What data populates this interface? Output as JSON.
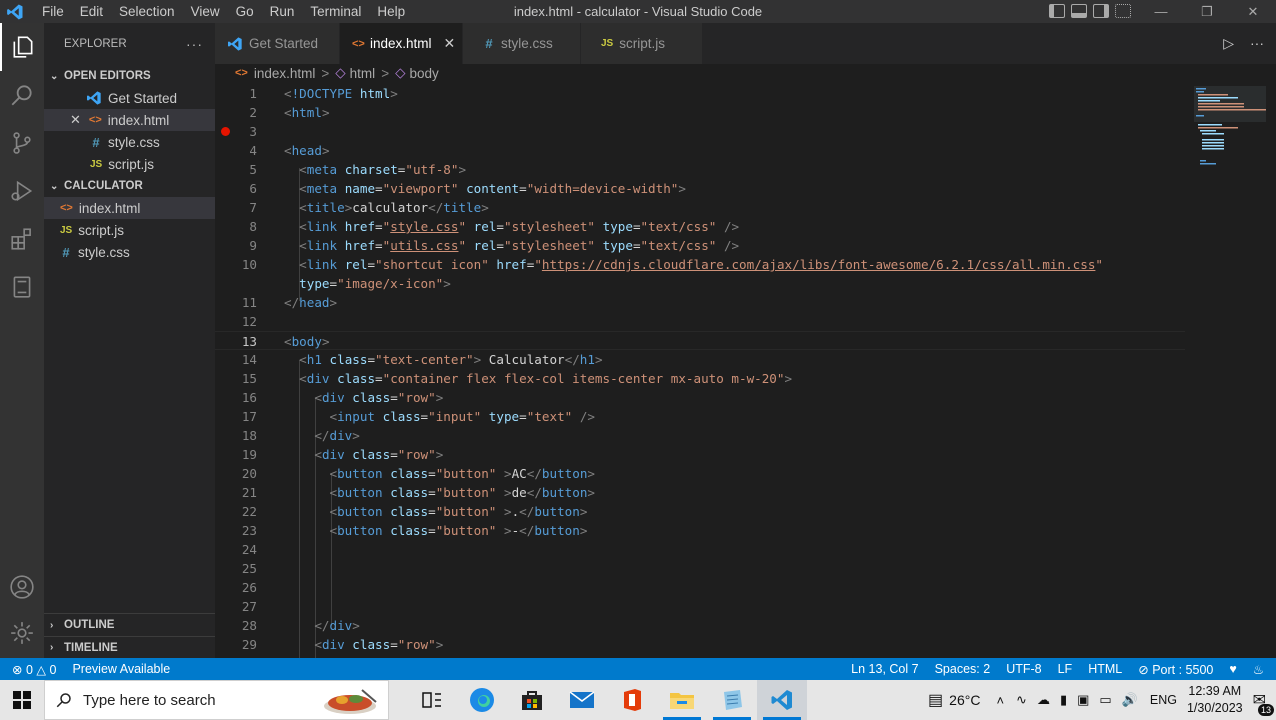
{
  "window": {
    "title": "index.html - calculator - Visual Studio Code",
    "menu": [
      "File",
      "Edit",
      "Selection",
      "View",
      "Go",
      "Run",
      "Terminal",
      "Help"
    ]
  },
  "activity": [
    "explorer-icon",
    "search-icon",
    "source-control-icon",
    "run-debug-icon",
    "extensions-icon",
    "remote-explorer-icon",
    "account-icon",
    "manage-gear-icon"
  ],
  "sidebar": {
    "title": "EXPLORER",
    "more": "···",
    "open_editors_label": "OPEN EDITORS",
    "open_editors": [
      {
        "icon": "vscode-icon",
        "label": "Get Started"
      },
      {
        "icon": "html-icon",
        "glyph": "<>",
        "label": "index.html",
        "close": "✕"
      },
      {
        "icon": "css-icon",
        "glyph": "#",
        "label": "style.css"
      },
      {
        "icon": "js-icon",
        "glyph": "JS",
        "label": "script.js"
      }
    ],
    "folder_label": "CALCULATOR",
    "files": [
      {
        "icon": "html-icon",
        "glyph": "<>",
        "label": "index.html"
      },
      {
        "icon": "js-icon",
        "glyph": "JS",
        "label": "script.js"
      },
      {
        "icon": "css-icon",
        "glyph": "#",
        "label": "style.css"
      }
    ],
    "outline_label": "OUTLINE",
    "timeline_label": "TIMELINE"
  },
  "tabs": [
    {
      "label": "Get Started",
      "glyph": ""
    },
    {
      "label": "index.html",
      "glyph": "<>",
      "close": "✕"
    },
    {
      "label": "style.css",
      "glyph": "#"
    },
    {
      "label": "script.js",
      "glyph": "JS"
    }
  ],
  "tab_actions": {
    "run": "▷",
    "more": "···"
  },
  "breadcrumb": {
    "file_glyph": "<>",
    "file": "index.html",
    "sep": ">",
    "html": "html",
    "body": "body"
  },
  "editor": {
    "line_numbers": [
      "1",
      "2",
      "3",
      "4",
      "5",
      "6",
      "7",
      "8",
      "9",
      "10",
      "",
      "11",
      "12",
      "13",
      "14",
      "15",
      "16",
      "17",
      "18",
      "19",
      "20",
      "21",
      "22",
      "23",
      "24",
      "25",
      "26",
      "27",
      "28",
      "29"
    ],
    "current_line": "13",
    "breakpoint_line": "3",
    "t": {
      "lt": "<",
      "gt": ">",
      "ltslash": "</",
      "slashgt": "/>",
      "eq": "=",
      "doctype": "!DOCTYPE",
      "html_tag": "html",
      "head": "head",
      "meta": "meta",
      "title": "title",
      "link": "link",
      "body": "body",
      "h1": "h1",
      "div": "div",
      "input": "input",
      "button": "button",
      "charset": "charset",
      "name": "name",
      "content": "content",
      "href": "href",
      "rel": "rel",
      "type": "type",
      "class": "class",
      "v_utf8": "\"utf-8\"",
      "v_viewport": "\"viewport\"",
      "v_width": "\"width=device-width\"",
      "q": "\"",
      "style_css": "style.css",
      "utils_css": "utils.css",
      "v_stylesheet": "\"stylesheet\"",
      "v_textcss": "\"text/css\"",
      "v_shortcut": "\"shortcut icon\"",
      "cdn_url": "https://cdnjs.cloudflare.com/ajax/libs/font-awesome/6.2.1/css/all.min.css",
      "v_imgicon": "\"image/x-icon\"",
      "calc_text": "calculator",
      "v_textcenter": "\"text-center\"",
      "h1_text": " Calculator",
      "v_container": "\"container flex flex-col items-center mx-auto m-w-20\"",
      "v_row": "\"row\"",
      "v_input": "\"input\"",
      "v_text": "\"text\"",
      "v_button": "\"button\"",
      "ac": "AC",
      "de": "de",
      "dot": ".",
      "minus": "-"
    }
  },
  "statusbar": {
    "errors": "0",
    "warnings": "0",
    "preview": "Preview Available",
    "position": "Ln 13, Col 7",
    "spaces": "Spaces: 2",
    "encoding": "UTF-8",
    "eol": "LF",
    "language": "HTML",
    "port": "Port : 5500"
  },
  "taskbar": {
    "search_placeholder": "Type here to search",
    "apps": [
      "task-view-icon",
      "edge-icon",
      "store-icon",
      "mail-icon",
      "office-icon",
      "file-explorer-icon",
      "notepad-icon",
      "vscode-icon"
    ],
    "weather": "26°C",
    "language": "ENG",
    "time": "12:39 AM",
    "date": "1/30/2023",
    "notifications": "13"
  },
  "colors": {
    "accent": "#007acc",
    "editor_bg": "#1e1e1e",
    "sidebar_bg": "#252526",
    "activity_bg": "#333333",
    "tag": "#569cd6",
    "attr": "#9cdcfe",
    "value": "#ce9178",
    "breakpoint": "#e51400"
  }
}
